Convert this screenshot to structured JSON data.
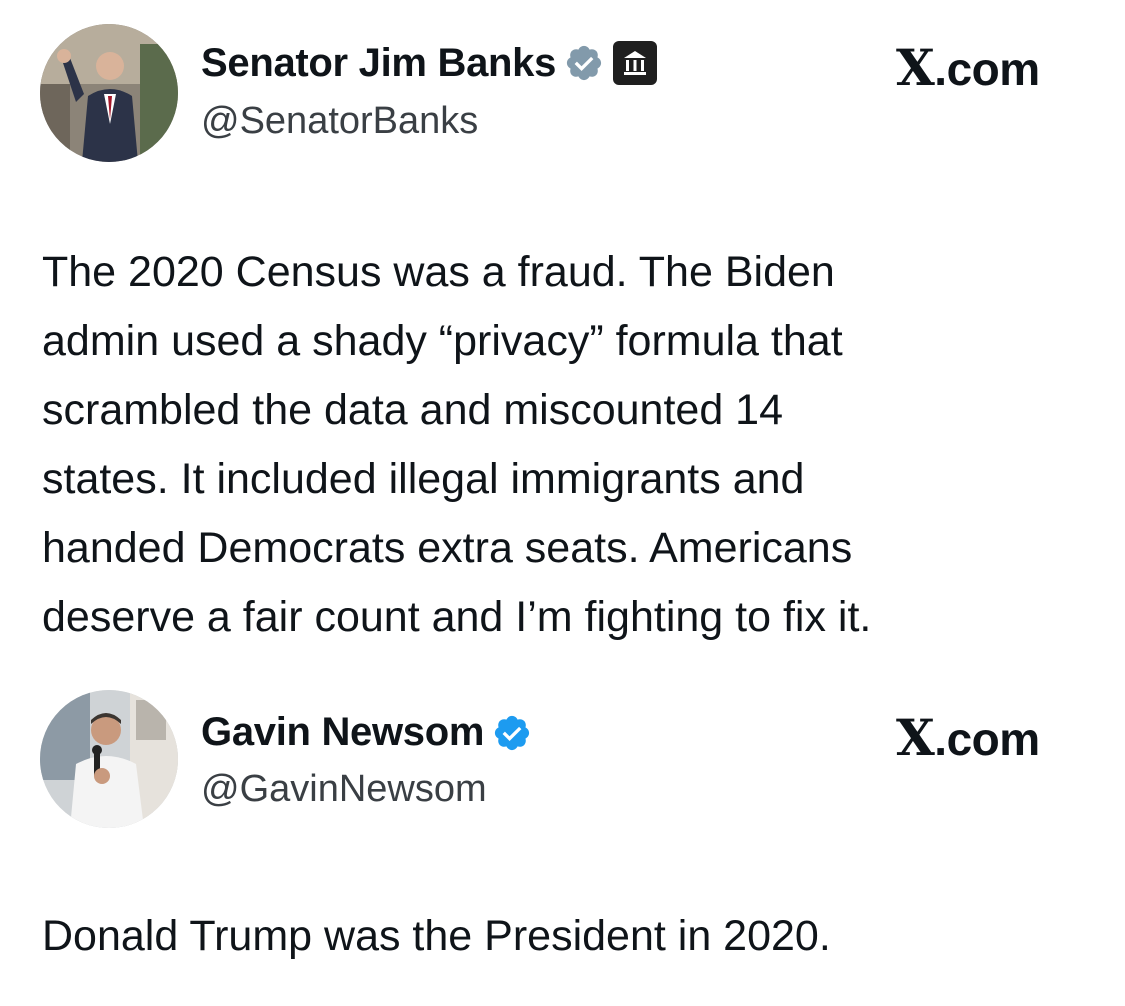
{
  "tweets": [
    {
      "author": {
        "display_name": "Senator Jim Banks",
        "handle": "@SenatorBanks",
        "verified_icon": "verified-badge-gray-icon",
        "affiliation_icon": "government-building-icon",
        "avatar": "senator-avatar"
      },
      "site_label_x": "X",
      "site_label_rest": ".com",
      "text_lines": [
        "The 2020 Census was a fraud. The Biden",
        "admin used a shady “privacy” formula that",
        "scrambled the data and miscounted 14",
        "states. It included illegal immigrants and",
        "handed Democrats extra seats. Americans",
        "deserve a fair count and I’m fighting to fix it."
      ]
    },
    {
      "author": {
        "display_name": "Gavin Newsom",
        "handle": "@GavinNewsom",
        "verified_icon": "verified-badge-blue-icon",
        "avatar": "newsom-avatar"
      },
      "site_label_x": "X",
      "site_label_rest": ".com",
      "text_lines": [
        "Donald Trump was the President in 2020."
      ]
    }
  ],
  "colors": {
    "text": "#0f1419",
    "handle": "#3a3f44",
    "verified_gray": "#829aab",
    "verified_blue": "#1d9bf0",
    "background": "#ffffff"
  }
}
